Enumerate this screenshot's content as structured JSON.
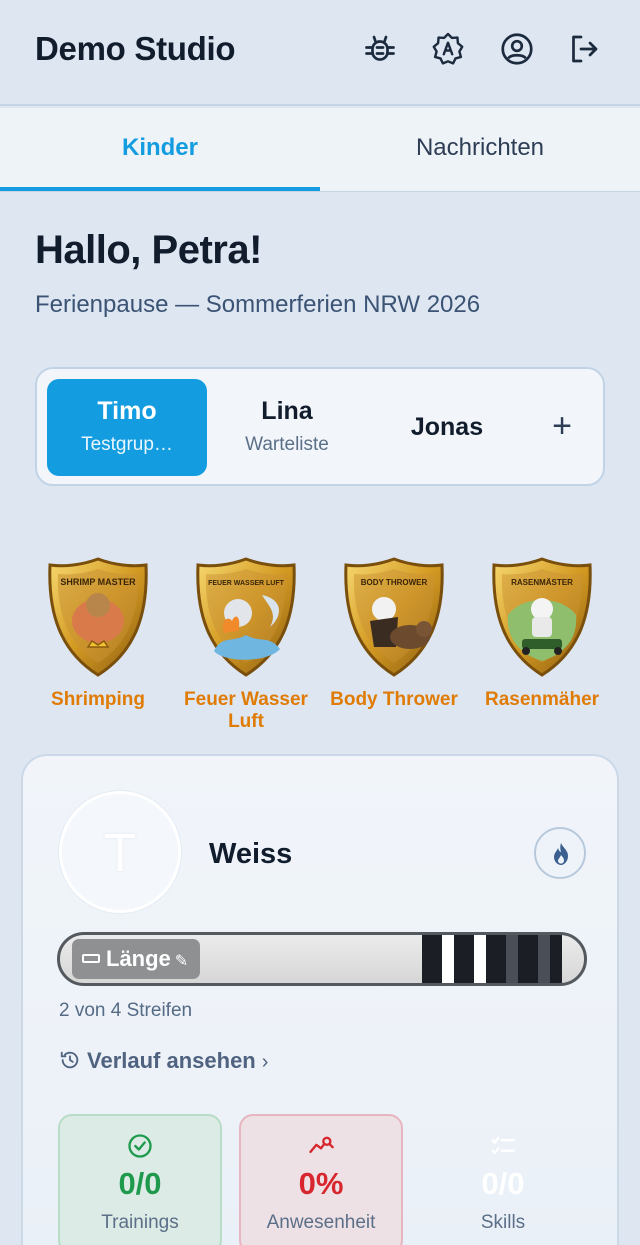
{
  "header": {
    "title": "Demo Studio",
    "icons": [
      "bug-icon",
      "translate-icon",
      "account-icon",
      "logout-icon"
    ]
  },
  "tabs": [
    {
      "label": "Kinder",
      "active": true
    },
    {
      "label": "Nachrichten",
      "active": false
    }
  ],
  "greeting": "Hallo, Petra!",
  "subtitle": "Ferienpause — Sommerferien NRW 2026",
  "kids": [
    {
      "name": "Timo",
      "sub": "Testgrup…",
      "selected": true
    },
    {
      "name": "Lina",
      "sub": "Warteliste",
      "selected": false
    },
    {
      "name": "Jonas",
      "sub": "",
      "selected": false
    }
  ],
  "add_kid_label": "+",
  "badges": [
    {
      "label": "Shrimping",
      "shield_text": "SHRIMP MASTER"
    },
    {
      "label": "Feuer Wasser Luft",
      "shield_text": "FEUER WASSER LUFT"
    },
    {
      "label": "Body Thrower",
      "shield_text": "BODY THROWER"
    },
    {
      "label": "Rasenmäher",
      "shield_text": "RASENMÄSTER"
    }
  ],
  "profile": {
    "avatar_initial": "T",
    "name": "Weiss",
    "belt_label": "Länge",
    "stripes_earned": 2,
    "stripes_total": 4,
    "stripes_text": "2 von 4 Streifen",
    "history_link": "Verlauf ansehen"
  },
  "stats": [
    {
      "value": "0/0",
      "label": "Trainings",
      "color": "#1f9a4c"
    },
    {
      "value": "0%",
      "label": "Anwesenheit",
      "color": "#d7262d"
    },
    {
      "value": "0/0",
      "label": "Skills",
      "color": "#ffffff"
    }
  ],
  "colors": {
    "accent": "#139de0",
    "badge_label": "#e07c06",
    "background": "#dde6f1"
  }
}
